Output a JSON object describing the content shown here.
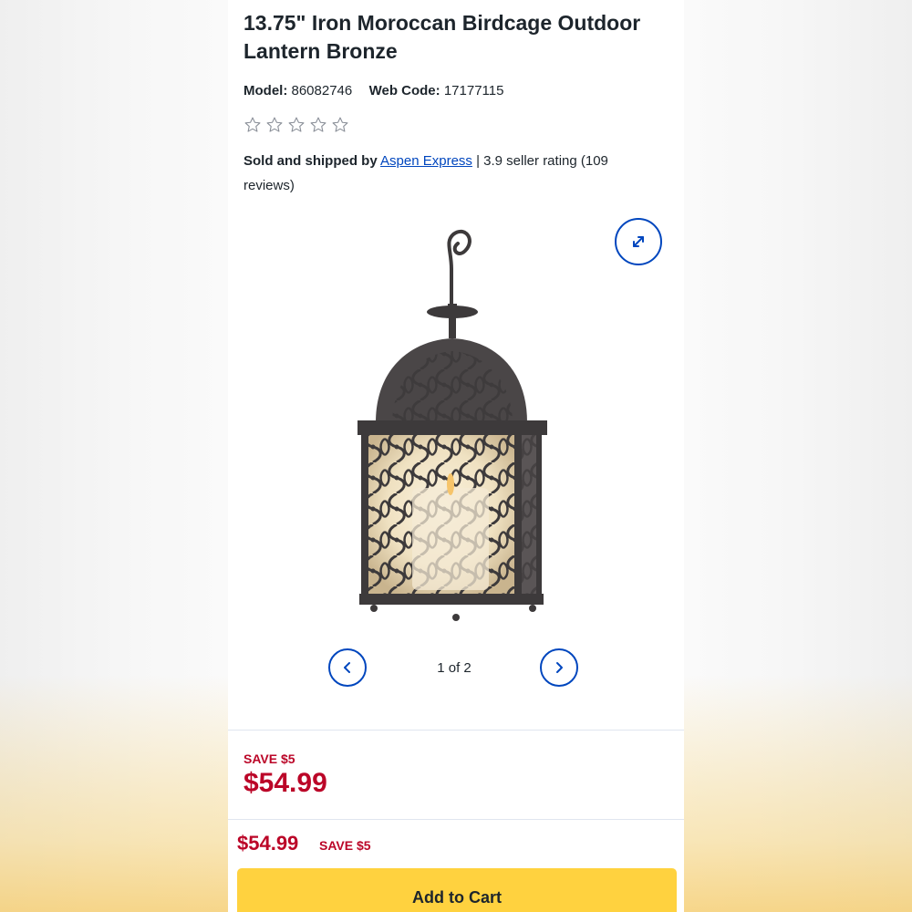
{
  "product": {
    "title": "13.75\" Iron Moroccan Birdcage Outdoor Lantern Bronze",
    "model_label": "Model:",
    "model_value": "86082746",
    "webcode_label": "Web Code:",
    "webcode_value": "17177115",
    "rating_stars": 0,
    "star_count": 5
  },
  "seller": {
    "prefix": "Sold and shipped by",
    "name": "Aspen Express",
    "suffix": "| 3.9 seller rating (109 reviews)"
  },
  "gallery": {
    "counter": "1 of 2",
    "expand_icon": "expand-arrows-icon",
    "prev_icon": "chevron-left-icon",
    "next_icon": "chevron-right-icon"
  },
  "pricing": {
    "save_label": "SAVE $5",
    "price": "$54.99"
  },
  "sticky_bar": {
    "price": "$54.99",
    "save_label": "SAVE $5",
    "add_to_cart": "Add to Cart"
  },
  "colors": {
    "accent_blue": "#0046be",
    "sale_red": "#bb0628",
    "cart_yellow": "#ffd23f",
    "text": "#1d252c"
  }
}
